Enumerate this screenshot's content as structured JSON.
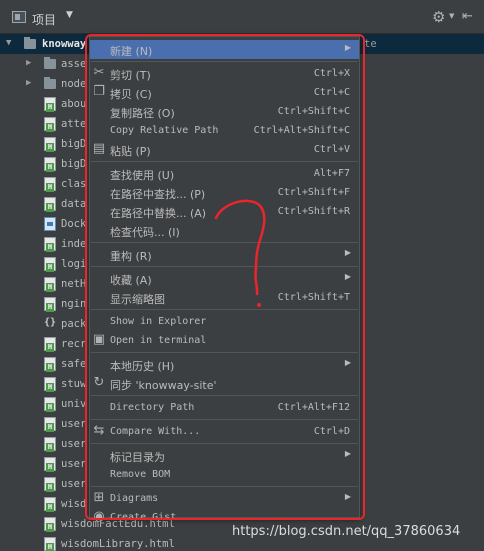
{
  "toolbar": {
    "project_label": "项目",
    "project_icon": "project-view-icon",
    "dropdown_glyph": "▼",
    "settings_icon": "gear-icon",
    "pin_icon": "hide-icon"
  },
  "tree": {
    "root": {
      "label": "knowway",
      "suffix": "te",
      "icon": "folder-icon"
    },
    "items": [
      {
        "label": "asse",
        "icon": "folder",
        "arrow": "▶"
      },
      {
        "label": "node",
        "icon": "folder",
        "arrow": "▶"
      },
      {
        "label": "abou",
        "icon": "html"
      },
      {
        "label": "atte",
        "icon": "html"
      },
      {
        "label": "bigD",
        "icon": "html"
      },
      {
        "label": "bigD",
        "icon": "html"
      },
      {
        "label": "clas",
        "icon": "html"
      },
      {
        "label": "data",
        "icon": "html"
      },
      {
        "label": "Dock",
        "icon": "docker"
      },
      {
        "label": "inde",
        "icon": "html"
      },
      {
        "label": "logi",
        "icon": "html"
      },
      {
        "label": "netH",
        "icon": "html"
      },
      {
        "label": "ngin",
        "icon": "html"
      },
      {
        "label": "pack",
        "icon": "json"
      },
      {
        "label": "recr",
        "icon": "html"
      },
      {
        "label": "safe",
        "icon": "html"
      },
      {
        "label": "stuw",
        "icon": "html"
      },
      {
        "label": "univ",
        "icon": "html"
      },
      {
        "label": "user",
        "icon": "html"
      },
      {
        "label": "user",
        "icon": "html"
      },
      {
        "label": "user",
        "icon": "html"
      },
      {
        "label": "user",
        "icon": "html"
      },
      {
        "label": "wisd",
        "icon": "html"
      },
      {
        "label": "wisdomFactEdu.html",
        "icon": "html"
      },
      {
        "label": "wisdomLibrary.html",
        "icon": "html"
      }
    ]
  },
  "context_menu": {
    "items": [
      {
        "label": "新建 (N)",
        "shortcut": "",
        "submenu": true,
        "icon": "",
        "mono": false,
        "highlight": true
      },
      {
        "label": "剪切 (T)",
        "shortcut": "Ctrl+X",
        "submenu": false,
        "icon": "scissors-icon",
        "mono": false,
        "sep_before": true
      },
      {
        "label": "拷贝 (C)",
        "shortcut": "Ctrl+C",
        "submenu": false,
        "icon": "copy-icon",
        "mono": false
      },
      {
        "label": "复制路径 (O)",
        "shortcut": "Ctrl+Shift+C",
        "submenu": false,
        "icon": "",
        "mono": false
      },
      {
        "label": "Copy Relative Path",
        "shortcut": "Ctrl+Alt+Shift+C",
        "submenu": false,
        "icon": "",
        "mono": true
      },
      {
        "label": "粘贴 (P)",
        "shortcut": "Ctrl+V",
        "submenu": false,
        "icon": "paste-icon",
        "mono": false
      },
      {
        "label": "查找使用 (U)",
        "shortcut": "Alt+F7",
        "submenu": false,
        "icon": "",
        "mono": false,
        "sep_before": true
      },
      {
        "label": "在路径中查找... (P)",
        "shortcut": "Ctrl+Shift+F",
        "submenu": false,
        "icon": "",
        "mono": false
      },
      {
        "label": "在路径中替换... (A)",
        "shortcut": "Ctrl+Shift+R",
        "submenu": false,
        "icon": "",
        "mono": false
      },
      {
        "label": "检查代码... (I)",
        "shortcut": "",
        "submenu": false,
        "icon": "",
        "mono": false
      },
      {
        "label": "重构 (R)",
        "shortcut": "",
        "submenu": true,
        "icon": "",
        "mono": false,
        "sep_before": true
      },
      {
        "label": "收藏 (A)",
        "shortcut": "",
        "submenu": true,
        "icon": "",
        "mono": false,
        "sep_before": true
      },
      {
        "label": "显示缩略图",
        "shortcut": "Ctrl+Shift+T",
        "submenu": false,
        "icon": "",
        "mono": false
      },
      {
        "label": "Show in Explorer",
        "shortcut": "",
        "submenu": false,
        "icon": "",
        "mono": true,
        "sep_before": true
      },
      {
        "label": "Open in terminal",
        "shortcut": "",
        "submenu": false,
        "icon": "terminal-icon",
        "mono": true
      },
      {
        "label": "本地历史 (H)",
        "shortcut": "",
        "submenu": true,
        "icon": "",
        "mono": false,
        "sep_before": true
      },
      {
        "label": "同步 'knowway-site'",
        "shortcut": "",
        "submenu": false,
        "icon": "sync-icon",
        "mono": false
      },
      {
        "label": "Directory Path",
        "shortcut": "Ctrl+Alt+F12",
        "submenu": false,
        "icon": "",
        "mono": true,
        "sep_before": true
      },
      {
        "label": "Compare With...",
        "shortcut": "Ctrl+D",
        "submenu": false,
        "icon": "compare-icon",
        "mono": true,
        "sep_before": true
      },
      {
        "label": "标记目录为",
        "shortcut": "",
        "submenu": true,
        "icon": "",
        "mono": false,
        "sep_before": true
      },
      {
        "label": "Remove BOM",
        "shortcut": "",
        "submenu": false,
        "icon": "",
        "mono": true
      },
      {
        "label": "Diagrams",
        "shortcut": "",
        "submenu": true,
        "icon": "diagram-icon",
        "mono": true,
        "sep_before": true
      },
      {
        "label": "Create Gist...",
        "shortcut": "",
        "submenu": false,
        "icon": "github-icon",
        "mono": true
      }
    ]
  },
  "annotation": {
    "glyph": "?"
  },
  "watermark": "https://blog.csdn.net/qq_37860634",
  "colors": {
    "background": "#3c3f41",
    "highlight": "#4b6eaf",
    "annotation_red": "#e8262b"
  }
}
